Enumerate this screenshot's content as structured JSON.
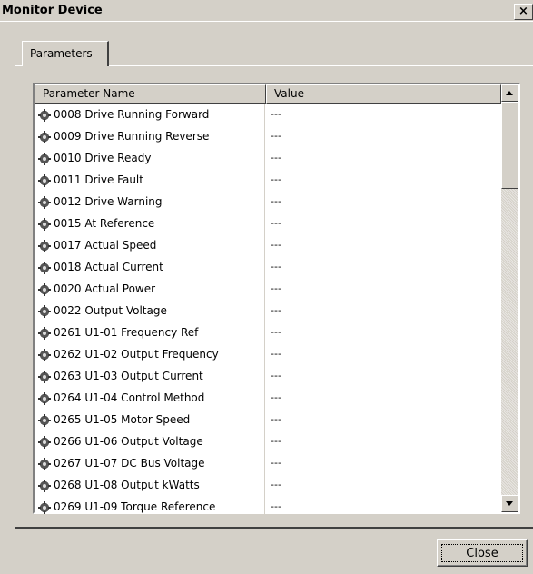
{
  "window": {
    "title": "Monitor Device",
    "close_glyph": "×"
  },
  "tabs": [
    {
      "label": "Parameters"
    }
  ],
  "table": {
    "columns": [
      "Parameter Name",
      "Value"
    ],
    "rows": [
      {
        "name": "0008 Drive Running Forward",
        "value": "---"
      },
      {
        "name": "0009 Drive Running Reverse",
        "value": "---"
      },
      {
        "name": "0010 Drive Ready",
        "value": "---"
      },
      {
        "name": "0011 Drive Fault",
        "value": "---"
      },
      {
        "name": "0012 Drive Warning",
        "value": "---"
      },
      {
        "name": "0015 At Reference",
        "value": "---"
      },
      {
        "name": "0017 Actual Speed",
        "value": "---"
      },
      {
        "name": "0018 Actual Current",
        "value": "---"
      },
      {
        "name": "0020 Actual Power",
        "value": "---"
      },
      {
        "name": "0022 Output Voltage",
        "value": "---"
      },
      {
        "name": "0261 U1-01 Frequency Ref",
        "value": "---"
      },
      {
        "name": "0262 U1-02 Output Frequency",
        "value": "---"
      },
      {
        "name": "0263 U1-03 Output Current",
        "value": "---"
      },
      {
        "name": "0264 U1-04 Control Method",
        "value": "---"
      },
      {
        "name": "0265 U1-05 Motor Speed",
        "value": "---"
      },
      {
        "name": "0266 U1-06 Output Voltage",
        "value": "---"
      },
      {
        "name": "0267 U1-07 DC Bus Voltage",
        "value": "---"
      },
      {
        "name": "0268 U1-08 Output kWatts",
        "value": "---"
      },
      {
        "name": "0269 U1-09 Torque Reference",
        "value": "---"
      }
    ],
    "row_icon": "gear-icon"
  },
  "buttons": {
    "close_label": "Close"
  },
  "colors": {
    "dialog_bg": "#d4d0c8",
    "list_bg": "#ffffff"
  }
}
